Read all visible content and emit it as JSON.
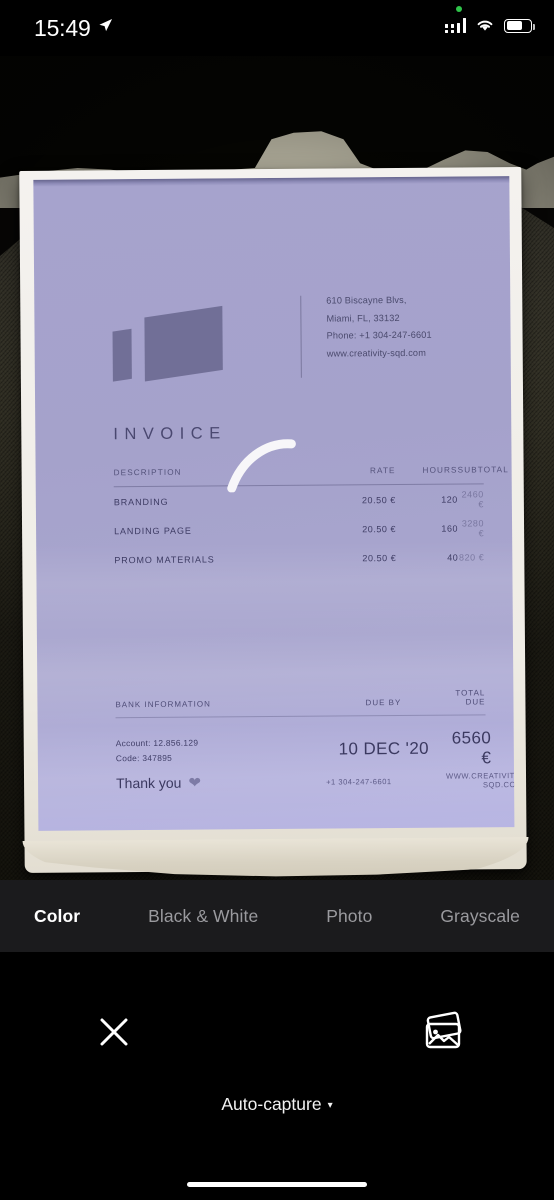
{
  "status_bar": {
    "time": "15:49",
    "location_icon": "location-arrow-icon",
    "cellular_icon": "cellular-signal-icon",
    "wifi_icon": "wifi-icon",
    "battery_icon": "battery-icon",
    "battery_level": "58%"
  },
  "document": {
    "logo_name": "creativity-sqd-logo",
    "address": {
      "line1": "610 Biscayne Blvs,",
      "line2": "Miami, FL, 33132",
      "line3": "Phone: +1 304-247-6601",
      "line4": "www.creativity-sqd.com"
    },
    "title": "INVOICE",
    "table": {
      "headers": {
        "description": "DESCRIPTION",
        "rate": "RATE",
        "hours": "HOURS",
        "subtotal": "SUBTOTAL"
      },
      "rows": [
        {
          "description": "BRANDING",
          "rate": "20.50 €",
          "hours": "120",
          "subtotal": "2460 €"
        },
        {
          "description": "LANDING PAGE",
          "rate": "20.50 €",
          "hours": "160",
          "subtotal": "3280 €"
        },
        {
          "description": "PROMO MATERIALS",
          "rate": "20.50 €",
          "hours": "40",
          "subtotal": "820 €"
        }
      ]
    },
    "bank": {
      "header_left": "BANK INFORMATION",
      "header_mid": "DUE BY",
      "header_right": "TOTAL DUE",
      "account": "Account: 12.856.129",
      "code": "Code: 347895",
      "due_by": "10 DEC '20",
      "total_due": "6560 €"
    },
    "footer": {
      "thanks": "Thank you",
      "heart_icon": "heart-icon",
      "phone": "+1 304-247-6601",
      "website": "WWW.CREATIVITY-SQD.COM"
    },
    "scan_indicator": "scanning-arc-indicator"
  },
  "modes": {
    "items": [
      {
        "label": "Color",
        "active": true
      },
      {
        "label": "Black & White",
        "active": false
      },
      {
        "label": "Photo",
        "active": false
      },
      {
        "label": "Grayscale",
        "active": false
      }
    ]
  },
  "controls": {
    "close_icon": "close-icon",
    "shutter": "shutter-button",
    "gallery_icon": "gallery-icon",
    "auto_capture_label": "Auto-capture",
    "auto_capture_caret": "▾",
    "home_indicator": "home-indicator"
  },
  "colors": {
    "document_bg": "#a6a3cd",
    "document_text": "#3d3b63",
    "app_bg": "#000000",
    "mode_bar_bg": "#1b1b1d",
    "accent_white": "#ffffff"
  }
}
